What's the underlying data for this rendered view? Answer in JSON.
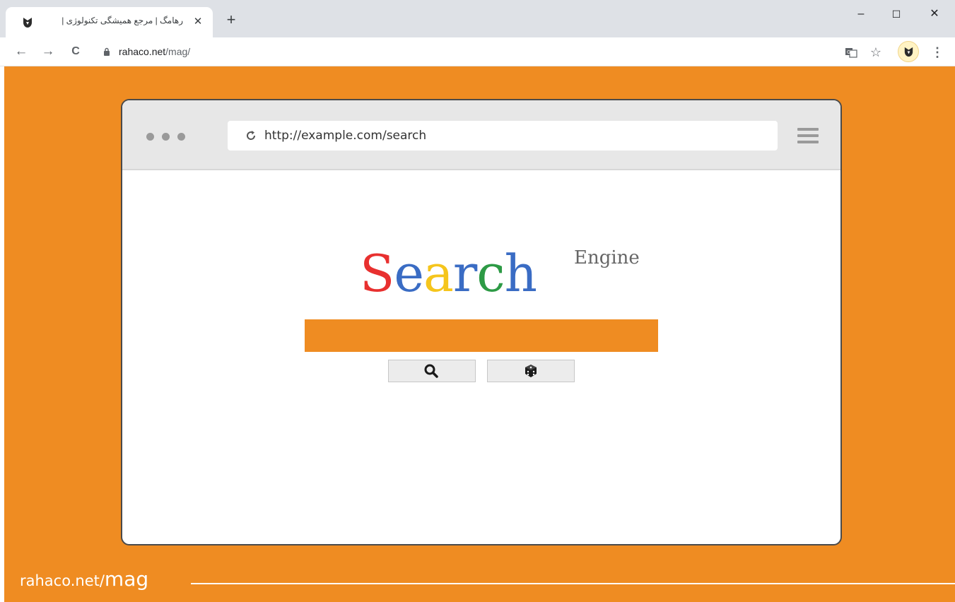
{
  "browser": {
    "tab_title": "رهامگ | مرجع همیشگی تکنولوژی |",
    "tab_close": "✕",
    "new_tab": "+",
    "window_minimize": "–",
    "window_maximize": "☐",
    "window_close": "✕",
    "nav_back": "←",
    "nav_forward": "→",
    "nav_reload": "C",
    "url_host": "rahaco.net",
    "url_path": "/mag/",
    "bookmark_star": "☆",
    "menu_dots": "⋮"
  },
  "illustration": {
    "address": "http://example.com/search",
    "logo_letters": [
      {
        "char": "S",
        "color": "#e8302f"
      },
      {
        "char": "e",
        "color": "#3a6cc4"
      },
      {
        "char": "a",
        "color": "#f5c51c"
      },
      {
        "char": "r",
        "color": "#3a6cc4"
      },
      {
        "char": "c",
        "color": "#2d9a45"
      },
      {
        "char": "h",
        "color": "#3a6cc4"
      }
    ],
    "logo_superscript": "Engine",
    "search_button_icon": "magnifier-icon",
    "lucky_button_icon": "dice-icon"
  },
  "watermark": {
    "host": "rahaco.net/",
    "path": "mag"
  },
  "colors": {
    "accent": "#ef8c22",
    "tabstrip": "#dee1e6"
  }
}
